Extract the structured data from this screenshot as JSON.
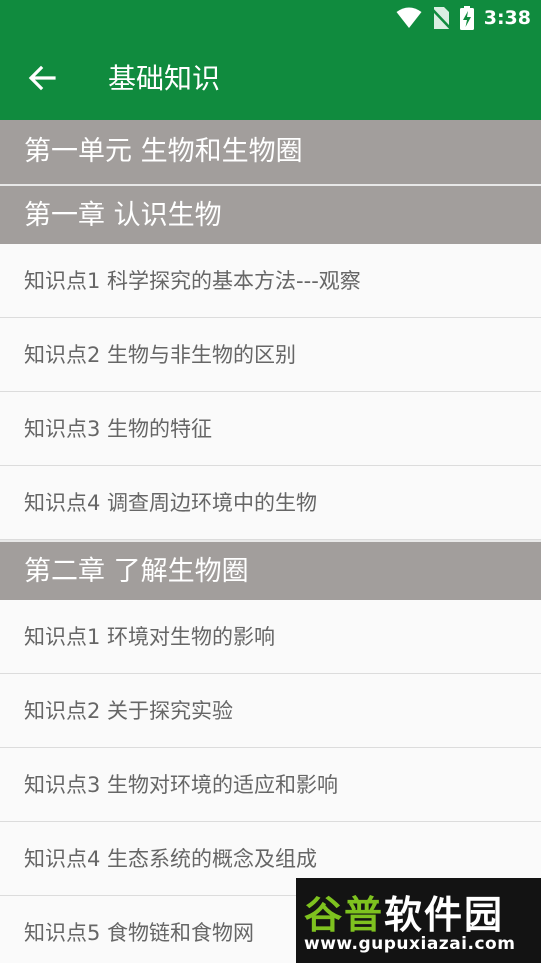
{
  "status_bar": {
    "time": "3:38",
    "icons": [
      "wifi-icon",
      "no-sim-icon",
      "battery-charging-icon"
    ]
  },
  "toolbar": {
    "back_icon": "arrow-left-icon",
    "title": "基础知识"
  },
  "colors": {
    "appbar": "#108b3e",
    "section_header": "#a29e9c",
    "item_text": "#666666",
    "watermark_green": "#7ec21f"
  },
  "unit": {
    "title": "第一单元 生物和生物圈"
  },
  "chapters": [
    {
      "title": "第一章 认识生物",
      "items": [
        "知识点1 科学探究的基本方法---观察",
        "知识点2 生物与非生物的区别",
        "知识点3 生物的特征",
        "知识点4 调查周边环境中的生物"
      ]
    },
    {
      "title": "第二章 了解生物圈",
      "items": [
        "知识点1 环境对生物的影响",
        "知识点2 关于探究实验",
        "知识点3 生物对环境的适应和影响",
        "知识点4 生态系统的概念及组成",
        "知识点5 食物链和食物网"
      ]
    }
  ],
  "watermark": {
    "brand_part1": "谷普",
    "brand_part2": "软件园",
    "url": "www.gupuxiazai.com"
  }
}
